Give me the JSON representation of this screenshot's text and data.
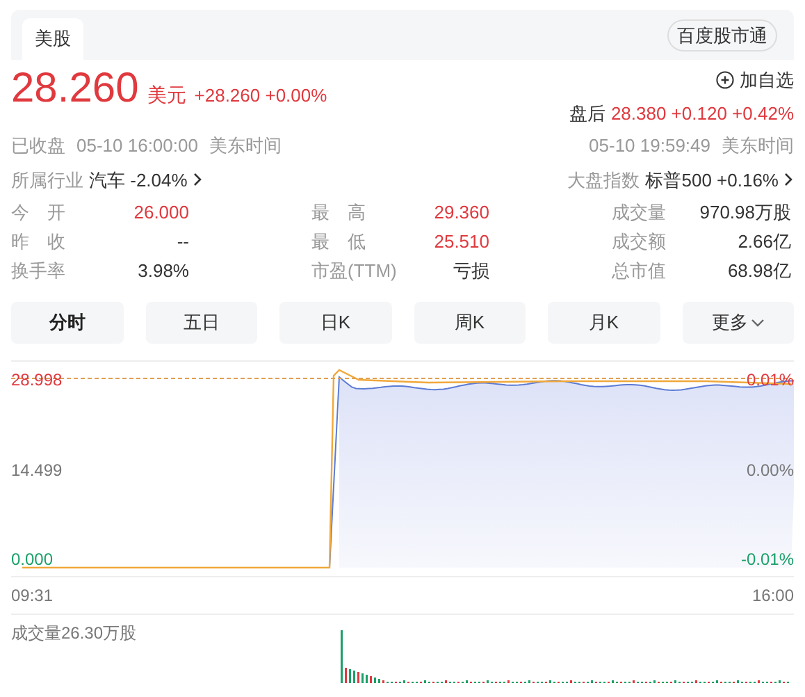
{
  "header": {
    "tabs": [
      {
        "label": "美股"
      }
    ],
    "source_badge": "百度股市通"
  },
  "quote": {
    "price": "28.260",
    "currency": "美元",
    "change": "+28.260 +0.00%",
    "watch_button": "加自选",
    "after_hours_label": "盘后",
    "after_hours_quote": "28.380 +0.120 +0.42%"
  },
  "status": {
    "state": "已收盘",
    "time": "05-10 16:00:00",
    "zone": "美东时间",
    "after_time": "05-10 19:59:49",
    "after_zone": "美东时间"
  },
  "industry": {
    "label": "所属行业",
    "value": "汽车 -2.04%"
  },
  "index": {
    "label": "大盘指数",
    "value": "标普500 +0.16%"
  },
  "stats": [
    {
      "label": "今　开",
      "value": "26.000",
      "color": "#e0393e"
    },
    {
      "label": "最　高",
      "value": "29.360",
      "color": "#e0393e"
    },
    {
      "label": "成交量",
      "value": "970.98万股",
      "color": "#333333"
    },
    {
      "label": "昨　收",
      "value": "--",
      "color": "#333333"
    },
    {
      "label": "最　低",
      "value": "25.510",
      "color": "#e0393e"
    },
    {
      "label": "成交额",
      "value": "2.66亿",
      "color": "#333333"
    },
    {
      "label": "换手率",
      "value": "3.98%",
      "color": "#333333"
    },
    {
      "label": "市盈(TTM)",
      "value": "亏损",
      "color": "#333333"
    },
    {
      "label": "总市值",
      "value": "68.98亿",
      "color": "#333333"
    }
  ],
  "chart_tabs": [
    {
      "label": "分时",
      "selected": true
    },
    {
      "label": "五日",
      "selected": false
    },
    {
      "label": "日K",
      "selected": false
    },
    {
      "label": "周K",
      "selected": false
    },
    {
      "label": "月K",
      "selected": false
    },
    {
      "label": "更多",
      "selected": false,
      "kind": "dropdown"
    }
  ],
  "chart": {
    "y_left": [
      {
        "label": "28.998",
        "color": "#e0393e"
      },
      {
        "label": "14.499",
        "color": "#777777"
      },
      {
        "label": "0.000",
        "color": "#1aa068"
      }
    ],
    "y_right": [
      {
        "label": "0.01%",
        "color": "#e0393e"
      },
      {
        "label": "0.00%",
        "color": "#777777"
      },
      {
        "label": "-0.01%",
        "color": "#1aa068"
      }
    ],
    "x_start": "09:31",
    "x_end": "16:00",
    "volume_label": "成交量26.30万股"
  }
}
